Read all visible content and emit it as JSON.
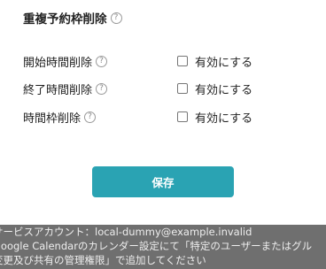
{
  "section": {
    "title": "重複予約枠削除",
    "help": "?"
  },
  "options": [
    {
      "label": "開始時間削除",
      "help": "?",
      "checkbox_label": "有効にする",
      "checked": false
    },
    {
      "label": "終了時間削除",
      "help": "?",
      "checkbox_label": "有効にする",
      "checked": false
    },
    {
      "label": "時間枠削除",
      "help": "?",
      "checkbox_label": "有効にする",
      "checked": false
    }
  ],
  "save_button": {
    "label": "保存"
  },
  "footer": {
    "line1": "サービスアカウント：local-dummy@example.invalid",
    "line2": "Google Calendarのカレンダー設定にて「特定のユーザーまたはグル",
    "line3": "変更及び共有の管理権限」で追加してください"
  },
  "colors": {
    "accent": "#2aa3b3",
    "footer_bg": "#6f6f6f"
  }
}
